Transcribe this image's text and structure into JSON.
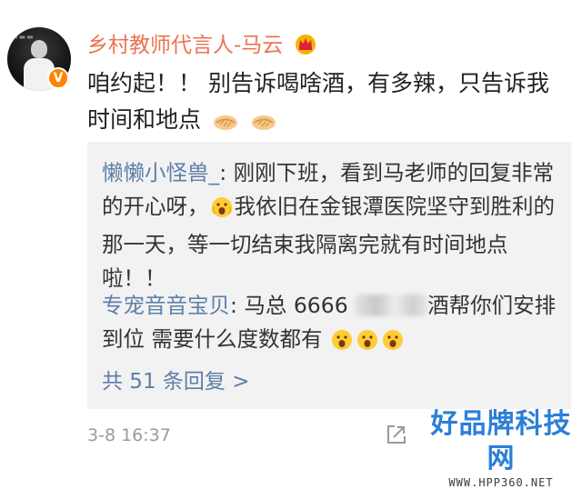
{
  "post": {
    "username": "乡村教师代言人-马云",
    "crown_icon": "crown-icon",
    "verified_badge": "V",
    "content_text": "咱约起！！ 别告诉喝啥酒，有多辣，只告诉我时间和地点",
    "content_emoji": "handshake-emoji",
    "timestamp": "3-8 16:37"
  },
  "replies": [
    {
      "author": "懒懒小怪兽_",
      "sep": ": ",
      "text_before": "刚刚下班，看到马老师的回复非常的开心呀，",
      "emoji": "face-with-open-mouth-emoji",
      "text_after": "我依旧在金银潭医院坚守到胜利的那一天，等一切结束我隔离完就有时间地点啦！！"
    },
    {
      "author": "专宠音音宝贝",
      "sep": ": ",
      "text_before": "马总 6666 ",
      "text_after": "酒帮你们安排到位 需要什么度数都有",
      "emoji": "face-with-open-mouth-emoji"
    }
  ],
  "more_replies_label": "共 51 条回复 >",
  "watermark": {
    "title": "好品牌科技网",
    "url": "WWW.HPP360.NET"
  },
  "colors": {
    "username": "#eb7350",
    "link": "#5d7fa8",
    "reply_bg": "#f2f2f2",
    "verified": "#ff8200"
  }
}
